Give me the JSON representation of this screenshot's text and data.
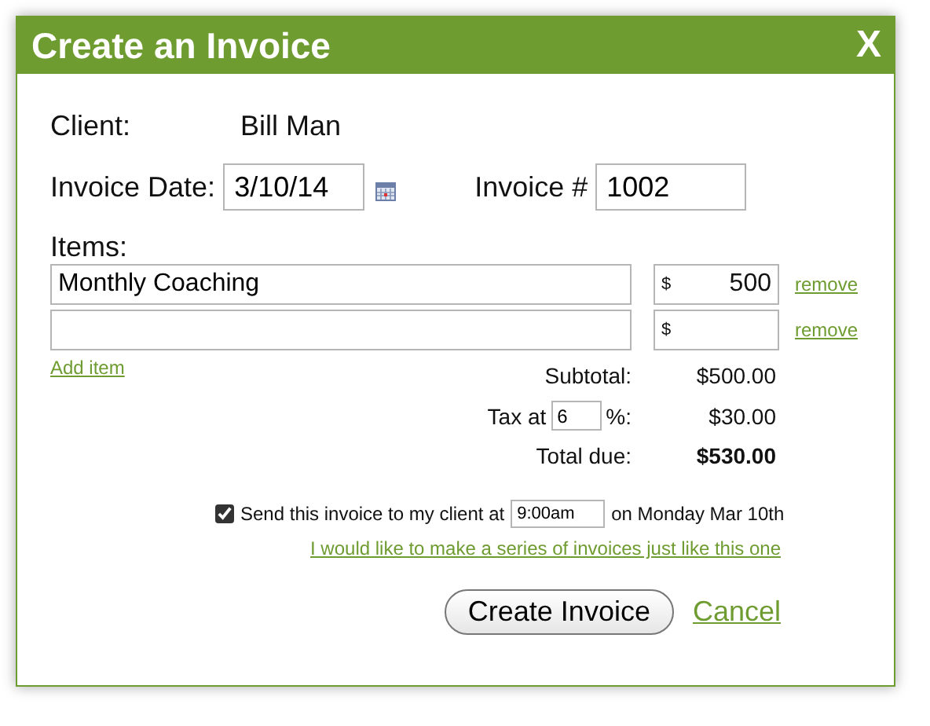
{
  "dialog": {
    "title": "Create an Invoice",
    "close": "X"
  },
  "client": {
    "label": "Client:",
    "value": "Bill Man"
  },
  "invoice_date": {
    "label": "Invoice Date:",
    "value": "3/10/14"
  },
  "invoice_number": {
    "label": "Invoice #",
    "value": "1002"
  },
  "items_label": "Items:",
  "items": [
    {
      "description": "Monthly Coaching",
      "currency": "$",
      "amount": "500",
      "remove": "remove"
    },
    {
      "currency": "$",
      "remove": "remove"
    }
  ],
  "add_item": "Add item",
  "subtotal": {
    "label": "Subtotal:",
    "value": "$500.00"
  },
  "tax": {
    "label_before": "Tax at",
    "rate": "6",
    "label_after": "%:",
    "value": "$30.00"
  },
  "total": {
    "label": "Total due:",
    "value": "$530.00"
  },
  "send": {
    "checked": true,
    "label_before": "Send this invoice to my client at",
    "time": "9:00am",
    "label_after": "on Monday Mar 10th"
  },
  "series_link": "I would like to make a series of invoices just like this one",
  "buttons": {
    "create": "Create Invoice",
    "cancel": "Cancel"
  }
}
